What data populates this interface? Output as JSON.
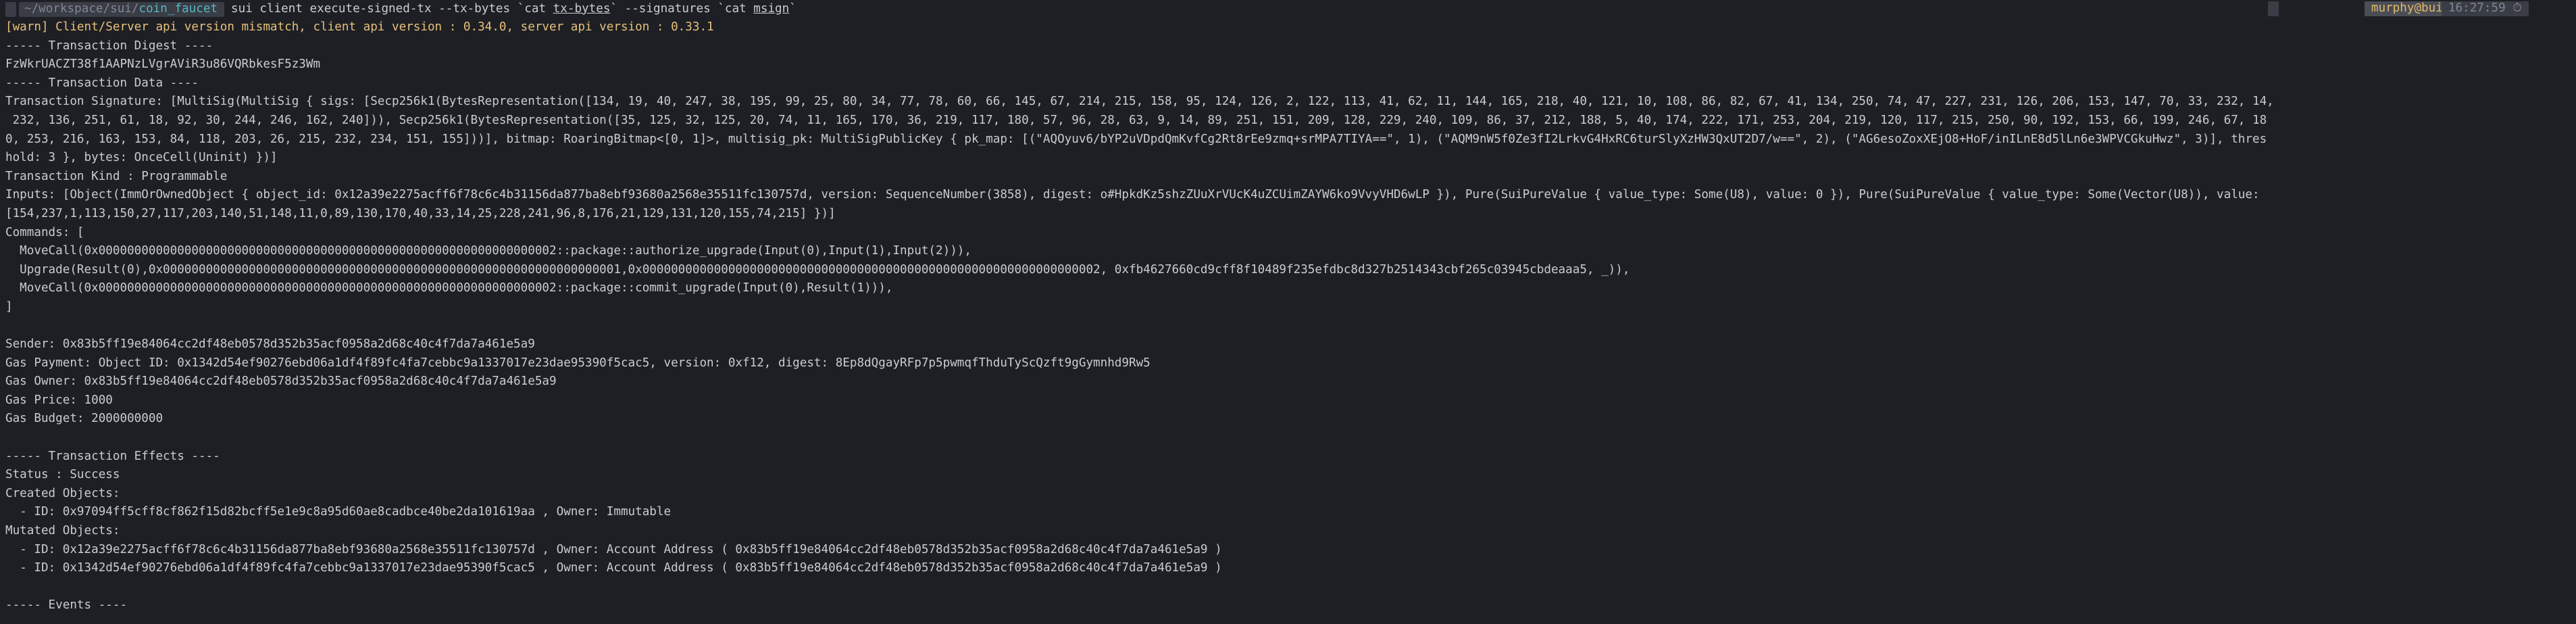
{
  "prompt": {
    "apple": "",
    "path_prefix": "~",
    "path_mid": "/workspace/sui/",
    "path_dir": "coin_faucet",
    "chevron": "",
    "cmd_pre": "sui client execute-signed-tx --tx-bytes `cat ",
    "cmd_u1": "tx-bytes",
    "cmd_mid": "` --signatures `cat ",
    "cmd_u2": "msign",
    "cmd_post": "`",
    "status_left": "",
    "user_host": "murphy@build",
    "time": "16:27:59 ⏱"
  },
  "output": {
    "warn": "[warn] Client/Server api version mismatch, client api version : 0.34.0, server api version : 0.33.1",
    "body": "----- Transaction Digest ----\nFzWkrUACZT38f1AAPNzLVgrAViR3u86VQRbkesF5z3Wm\n----- Transaction Data ----\nTransaction Signature: [MultiSig(MultiSig { sigs: [Secp256k1(BytesRepresentation([134, 19, 40, 247, 38, 195, 99, 25, 80, 34, 77, 78, 60, 66, 145, 67, 214, 215, 158, 95, 124, 126, 2, 122, 113, 41, 62, 11, 144, 165, 218, 40, 121, 10, 108, 86, 82, 67, 41, 134, 250, 74, 47, 227, 231, 126, 206, 153, 147, 70, 33, 232, 14,\n 232, 136, 251, 61, 18, 92, 30, 244, 246, 162, 240])), Secp256k1(BytesRepresentation([35, 125, 32, 125, 20, 74, 11, 165, 170, 36, 219, 117, 180, 57, 96, 28, 63, 9, 14, 89, 251, 151, 209, 128, 229, 240, 109, 86, 37, 212, 188, 5, 40, 174, 222, 171, 253, 204, 219, 120, 117, 215, 250, 90, 192, 153, 66, 199, 246, 67, 18\n0, 253, 216, 163, 153, 84, 118, 203, 26, 215, 232, 234, 151, 155]))], bitmap: RoaringBitmap<[0, 1]>, multisig_pk: MultiSigPublicKey { pk_map: [(\"AQOyuv6/bYP2uVDpdQmKvfCg2Rt8rEe9zmq+srMPA7TIYA==\", 1), (\"AQM9nW5f0Ze3fI2LrkvG4HxRC6turSlyXzHW3QxUT2D7/w==\", 2), (\"AG6esoZoxXEjO8+HoF/inILnE8d5lLn6e3WPVCGkuHwz\", 3)], thres\nhold: 3 }, bytes: OnceCell(Uninit) })]\nTransaction Kind : Programmable\nInputs: [Object(ImmOrOwnedObject { object_id: 0x12a39e2275acff6f78c6c4b31156da877ba8ebf93680a2568e35511fc130757d, version: SequenceNumber(3858), digest: o#HpkdKz5shzZUuXrVUcK4uZCUimZAYW6ko9VvyVHD6wLP }), Pure(SuiPureValue { value_type: Some(U8), value: 0 }), Pure(SuiPureValue { value_type: Some(Vector(U8)), value:\n[154,237,1,113,150,27,117,203,140,51,148,11,0,89,130,170,40,33,14,25,228,241,96,8,176,21,129,131,120,155,74,215] })]\nCommands: [\n  MoveCall(0x0000000000000000000000000000000000000000000000000000000000000002::package::authorize_upgrade(Input(0),Input(1),Input(2))),\n  Upgrade(Result(0),0x0000000000000000000000000000000000000000000000000000000000000001,0x0000000000000000000000000000000000000000000000000000000000000002, 0xfb4627660cd9cff8f10489f235efdbc8d327b2514343cbf265c03945cbdeaaa5, _)),\n  MoveCall(0x0000000000000000000000000000000000000000000000000000000000000002::package::commit_upgrade(Input(0),Result(1))),\n]\n\nSender: 0x83b5ff19e84064cc2df48eb0578d352b35acf0958a2d68c40c4f7da7a461e5a9\nGas Payment: Object ID: 0x1342d54ef90276ebd06a1df4f89fc4fa7cebbc9a1337017e23dae95390f5cac5, version: 0xf12, digest: 8Ep8dQgayRFp7p5pwmqfThduTyScQzft9gGymnhd9Rw5\nGas Owner: 0x83b5ff19e84064cc2df48eb0578d352b35acf0958a2d68c40c4f7da7a461e5a9\nGas Price: 1000\nGas Budget: 2000000000\n\n----- Transaction Effects ----\nStatus : Success\nCreated Objects:\n  - ID: 0x97094ff5cff8cf862f15d82bcff5e1e9c8a95d60ae8cadbce40be2da101619aa , Owner: Immutable\nMutated Objects:\n  - ID: 0x12a39e2275acff6f78c6c4b31156da877ba8ebf93680a2568e35511fc130757d , Owner: Account Address ( 0x83b5ff19e84064cc2df48eb0578d352b35acf0958a2d68c40c4f7da7a461e5a9 )\n  - ID: 0x1342d54ef90276ebd06a1df4f89fc4fa7cebbc9a1337017e23dae95390f5cac5 , Owner: Account Address ( 0x83b5ff19e84064cc2df48eb0578d352b35acf0958a2d68c40c4f7da7a461e5a9 )\n\n----- Events ----"
  },
  "colors": {
    "background": "#1e1f24",
    "text": "#c8ccd4",
    "warn": "#e5c07b",
    "directory": "#56b6c2",
    "user_host": "#e3b86a"
  }
}
